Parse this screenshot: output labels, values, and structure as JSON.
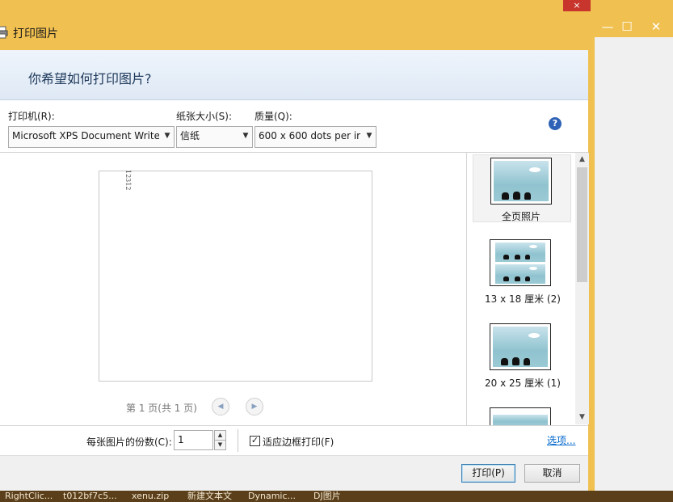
{
  "dialog": {
    "title": "打印图片",
    "close_glyph": "×",
    "banner_question": "你希望如何打印图片?"
  },
  "printer": {
    "label": "打印机(R):",
    "value": "Microsoft XPS Document Write"
  },
  "paper_size": {
    "label": "纸张大小(S):",
    "value": "信纸"
  },
  "quality": {
    "label": "质量(Q):",
    "value": "600 x 600 dots per ir"
  },
  "help": {
    "glyph": "?"
  },
  "preview": {
    "page_text": "12312",
    "page_info": "第 1 页(共 1 页)",
    "prev_glyph": "◀",
    "next_glyph": "▶"
  },
  "layouts": [
    {
      "label": "全页照片",
      "selected": true
    },
    {
      "label": "13 x 18 厘米 (2)",
      "selected": false
    },
    {
      "label": "20 x 25 厘米 (1)",
      "selected": false
    }
  ],
  "scroll": {
    "up": "▲",
    "down": "▼"
  },
  "copies": {
    "label": "每张图片的份数(C):",
    "value": "1",
    "up": "▲",
    "down": "▼"
  },
  "fit_frame": {
    "label": "适应边框打印(F)",
    "checked": true,
    "check_glyph": "✓"
  },
  "options_link": "选项...",
  "buttons": {
    "print": "打印(P)",
    "cancel": "取消"
  },
  "background_window": {
    "min": "—",
    "max": "☐",
    "close": "✕"
  },
  "taskbar": [
    "RightClic...",
    "t012bf7c5...",
    "xenu.zip",
    "新建文本文",
    "Dynamic...",
    "DJ图片"
  ],
  "colors": {
    "title_bar": "#f0c050",
    "accent_blue": "#1e395b",
    "close_red": "#c7352c",
    "link": "#0066cc"
  }
}
